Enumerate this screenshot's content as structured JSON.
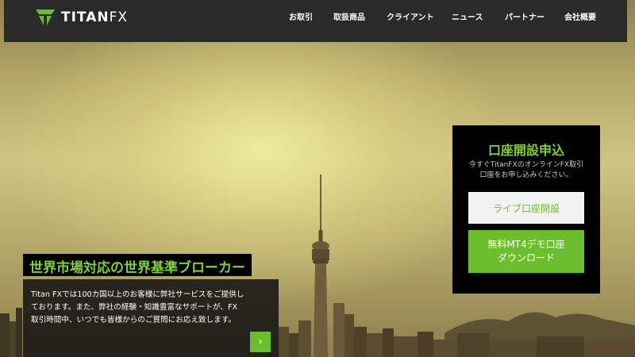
{
  "brand": {
    "logo_text_main": "TITAN",
    "logo_text_fx": "FX",
    "logo_icon": "titanfx-trident-icon",
    "accent_color": "#6cbf2c"
  },
  "nav": {
    "items": [
      {
        "label": "お取引"
      },
      {
        "label": "取扱商品"
      },
      {
        "label": "クライアント"
      },
      {
        "label": "ニュース"
      },
      {
        "label": "パートナー"
      },
      {
        "label": "会社概要"
      }
    ]
  },
  "signup": {
    "title": "口座開設申込",
    "desc_line1": "今すぐTitanFXのオンラインFX取引",
    "desc_line2": "口座をお申し込みください。",
    "live_button": "ライブ口座開設",
    "demo_line1": "無料MT4デモ口座",
    "demo_line2": "ダウンロード"
  },
  "hero": {
    "headline": "世界市場対応の世界基準ブローカー",
    "intro_line1": "Titan FXでは100カ国以上のお客様に弊社サービスをご提供し",
    "intro_line2": "ております。また、弊社の経験・知識豊富なサポートが、FX",
    "intro_line3": "取引時間中、いつでも皆様からのご質問にお応え致します。",
    "arrow_icon": "chevron-right-icon",
    "arrow_glyph": "›"
  }
}
